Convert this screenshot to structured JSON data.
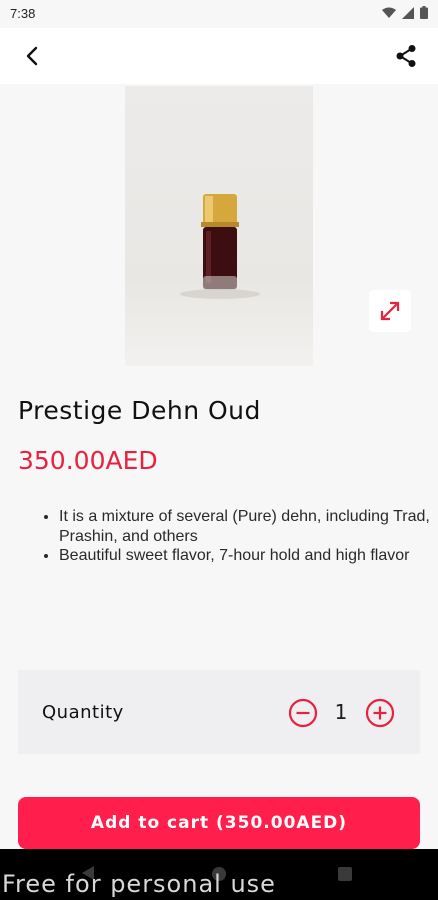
{
  "status_bar": {
    "time": "7:38",
    "icons": [
      "wifi-icon",
      "signal-icon",
      "battery-icon"
    ]
  },
  "app_bar": {
    "back_icon": "chevron-left-icon",
    "share_icon": "share-icon"
  },
  "product": {
    "title": "Prestige Dehn Oud",
    "price": "350.00AED",
    "features": [
      "It is a mixture of several (Pure) dehn, including Trad, Prashin, and others",
      "Beautiful sweet flavor, 7-hour hold and high flavor"
    ]
  },
  "quantity": {
    "label": "Quantity",
    "value": "1"
  },
  "cart": {
    "button_label": "Add to cart (350.00AED)"
  },
  "watermark": "Free for personal use",
  "colors": {
    "accent": "#ff1e4c",
    "price": "#e8223e",
    "panel": "#efeef0"
  }
}
